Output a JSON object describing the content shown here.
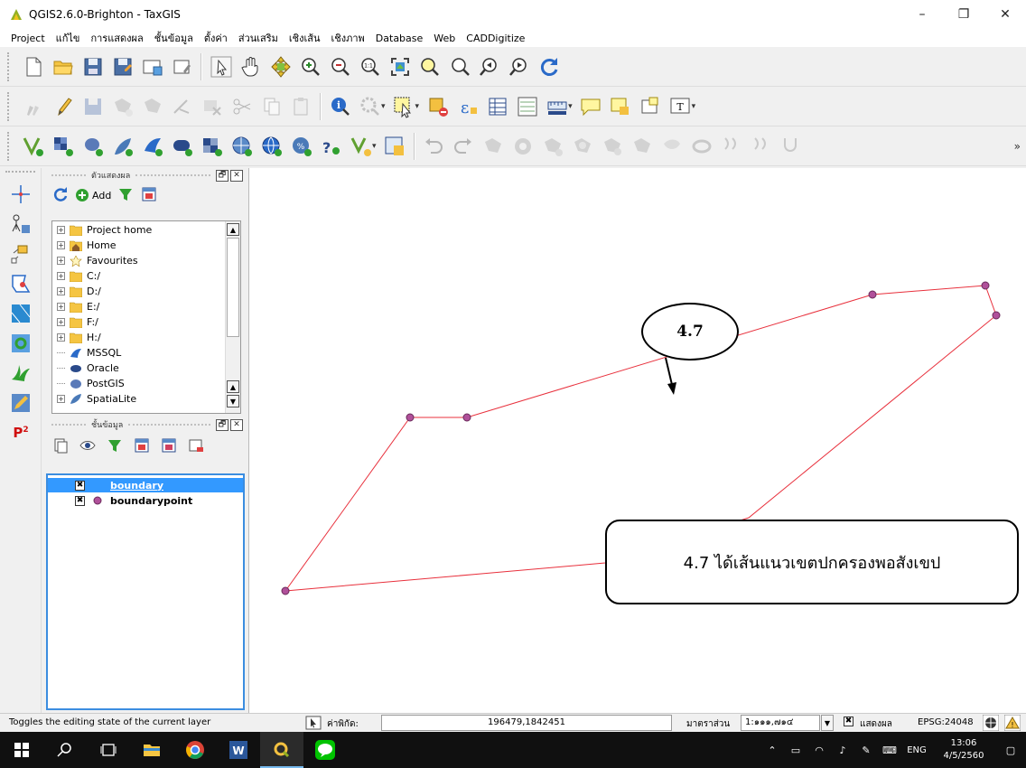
{
  "window": {
    "title": "QGIS2.6.0-Brighton - TaxGIS",
    "minimize": "–",
    "maximize": "❐",
    "close": "✕"
  },
  "menu": [
    "Project",
    "แก้ไข",
    "การแสดงผล",
    "ชั้นข้อมูล",
    "ตั้งค่า",
    "ส่วนเสริม",
    "เชิงเส้น",
    "เชิงภาพ",
    "Database",
    "Web",
    "CADDigitize"
  ],
  "toolbar_more": "»",
  "browser_panel": {
    "title": "ตัวแสดงผล",
    "add_label": "Add",
    "items": [
      {
        "label": "Project home",
        "icon": "folder-icon",
        "expandable": true
      },
      {
        "label": "Home",
        "icon": "home-folder-icon",
        "expandable": true
      },
      {
        "label": "Favourites",
        "icon": "star-icon",
        "expandable": true
      },
      {
        "label": "C:/",
        "icon": "folder-icon",
        "expandable": true
      },
      {
        "label": "D:/",
        "icon": "folder-icon",
        "expandable": true
      },
      {
        "label": "E:/",
        "icon": "folder-icon",
        "expandable": true
      },
      {
        "label": "F:/",
        "icon": "folder-icon",
        "expandable": true
      },
      {
        "label": "H:/",
        "icon": "folder-icon",
        "expandable": true
      },
      {
        "label": "MSSQL",
        "icon": "mssql-icon",
        "expandable": false
      },
      {
        "label": "Oracle",
        "icon": "oracle-icon",
        "expandable": false
      },
      {
        "label": "PostGIS",
        "icon": "postgis-icon",
        "expandable": false
      },
      {
        "label": "SpatiaLite",
        "icon": "spatialite-icon",
        "expandable": true
      }
    ]
  },
  "layers_panel": {
    "title": "ชั้นข้อมูล",
    "layers": [
      {
        "name": "boundary",
        "checked": "✖",
        "selected": true
      },
      {
        "name": "boundarypoint",
        "checked": "✖",
        "selected": false
      }
    ]
  },
  "map": {
    "line_color": "#e8303c",
    "vertex_color": "#b0509a",
    "callout_label": "4.7",
    "note_text": "4.7 ได้เส้นแนวเขตปกครองพอสังเขป"
  },
  "status": {
    "message": "Toggles the editing state of the current layer",
    "coord_label": "ค่าพิกัด:",
    "coord_value": "196479,1842451",
    "scale_label": "มาตราส่วน",
    "scale_value": "1:๑๑๑,๗๑๔",
    "render_label": "แสดงผล",
    "render_checked": "✖",
    "crs": "EPSG:24048"
  },
  "taskbar": {
    "lang": "ENG",
    "time": "13:06",
    "date": "4/5/2560"
  }
}
